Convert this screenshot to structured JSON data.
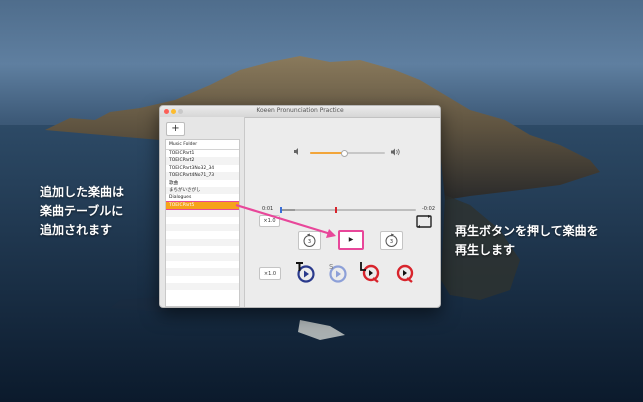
{
  "window": {
    "title": "Koeen Pronunciation Practice",
    "add_label": "+"
  },
  "table": {
    "header": "Music Folder",
    "rows": [
      "TOEICPart1",
      "TOEICPart2",
      "TOEICPart3No32_34",
      "TOEICPart4No71_73",
      "歌曲",
      "まちがいさがし",
      "Dialogues",
      "TOEICPart5"
    ],
    "selected": "TOEICPart5"
  },
  "player": {
    "time_elapsed": "0:01",
    "time_remaining": "-0:02",
    "speed_top": "×1.0",
    "speed_bottom": "×1.0",
    "play_label": "▶",
    "volume_level": 0.45,
    "seek_level": 0.1
  },
  "annotations": {
    "left_line1": "追加した楽曲は",
    "left_line2": "楽曲テーブルに",
    "left_line3": "追加されます",
    "right_line1": "再生ボタンを押して楽曲を",
    "right_line2": "再生します"
  },
  "colors": {
    "accent_orange": "#f2a53a",
    "highlight_pink": "#e8479a",
    "icon_blue": "#2a3a8c",
    "icon_red": "#d8242c"
  }
}
